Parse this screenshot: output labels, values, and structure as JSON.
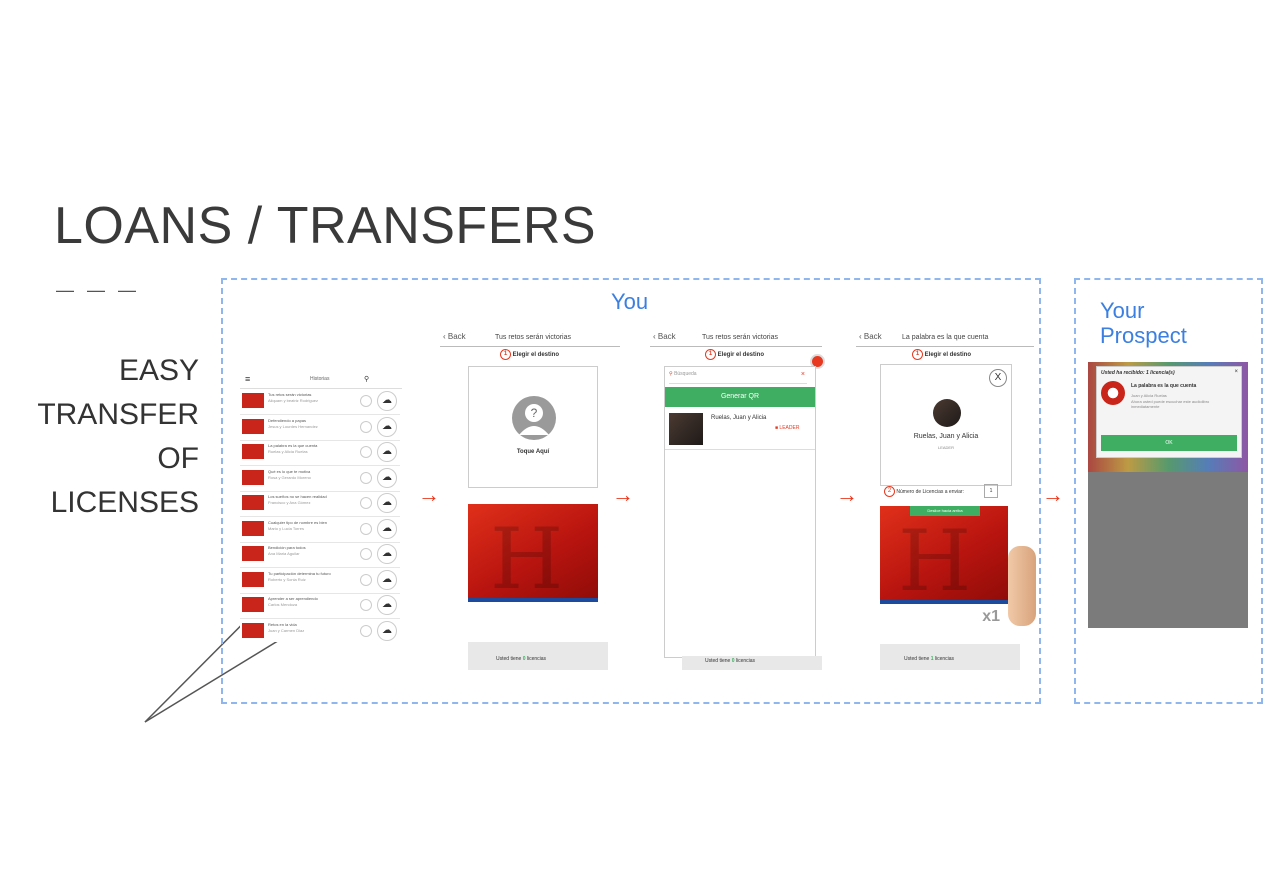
{
  "slide": {
    "title": "LOANS / TRANSFERS",
    "dashes": "— — —",
    "side_lines": [
      "EASY",
      "TRANSFER",
      "OF",
      "LICENSES"
    ]
  },
  "you_box": {
    "label": "You"
  },
  "prospect_box": {
    "label_line1": "Your",
    "label_line2": "Prospect"
  },
  "screen1": {
    "header": "Historias",
    "rows": [
      {
        "title": "Tus retos serán victorias",
        "sub": "Aliquam y beatriz Rodriguez"
      },
      {
        "title": "Defendiendo a papas",
        "sub": "Jesus y Lourdes Hernandez"
      },
      {
        "title": "La palabra es la que cuenta",
        "sub": "Ruelas y Alicia Ruelas"
      },
      {
        "title": "Qué es lo que te motiva",
        "sub": "Rosa y Gerardo Moreno"
      },
      {
        "title": "Los sueños no se hacen realidad",
        "sub": "Francisco y Ana Gómez"
      },
      {
        "title": "Cualquier tipo de nombre es bien",
        "sub": "Mario y Lucia Torres"
      },
      {
        "title": "Bendición para todos",
        "sub": "Ana Maria Aguilar"
      },
      {
        "title": "Tu participación determina tu futuro",
        "sub": "Roberto y Sonia Ruiz"
      },
      {
        "title": "Aprender a ser aprendiendo",
        "sub": "Carlos Mendoza"
      },
      {
        "title": "Retos en la vida",
        "sub": "Juan y Carmen Diaz"
      }
    ]
  },
  "screen2": {
    "back": "Back",
    "title": "Tus retos serán victorias",
    "step_num": "1",
    "step_label": "Elegir el destino",
    "tap_label": "Toque Aquí",
    "footer_prefix": "Usted tiene",
    "footer_count": "0",
    "footer_suffix": "licencias"
  },
  "screen3": {
    "back": "Back",
    "title": "Tus retos serán victorias",
    "step_num": "1",
    "step_label": "Elegir el destino",
    "search_placeholder": "Búsqueda",
    "generate_button": "Generar QR",
    "contact_name": "Ruelas, Juan y Alicia",
    "contact_badge": "LEADER",
    "footer_prefix": "Usted tiene",
    "footer_count": "0",
    "footer_suffix": "licencias"
  },
  "screen4": {
    "back": "Back",
    "title": "La palabra es la que cuenta",
    "step_num": "1",
    "step_label": "Elegir el destino",
    "close_label": "X",
    "contact_name": "Ruelas, Juan y Alicia",
    "contact_role": "LEADER",
    "step2_num": "2",
    "licenses_label": "Número de Licencias a enviar:",
    "licenses_value": "1",
    "drag_label": "Deslice hacia arriba",
    "cover_badge": "x1",
    "footer_prefix": "Usted tiene",
    "footer_count": "1",
    "footer_suffix": "licencias"
  },
  "screen5": {
    "dialog_title": "Usted ha recibido: 1 licencia(s)",
    "book_title": "La palabra es la que cuenta",
    "book_author": "Juan y Alicia Ruelas",
    "body_text": "Ahora usted puede escuchar este audiolibro inmediatamente",
    "ok_button": "OK"
  },
  "colors": {
    "accent_blue": "#3b7fe0",
    "arrow_red": "#e8381f",
    "green": "#3fae62",
    "book_red": "#c9251a"
  }
}
